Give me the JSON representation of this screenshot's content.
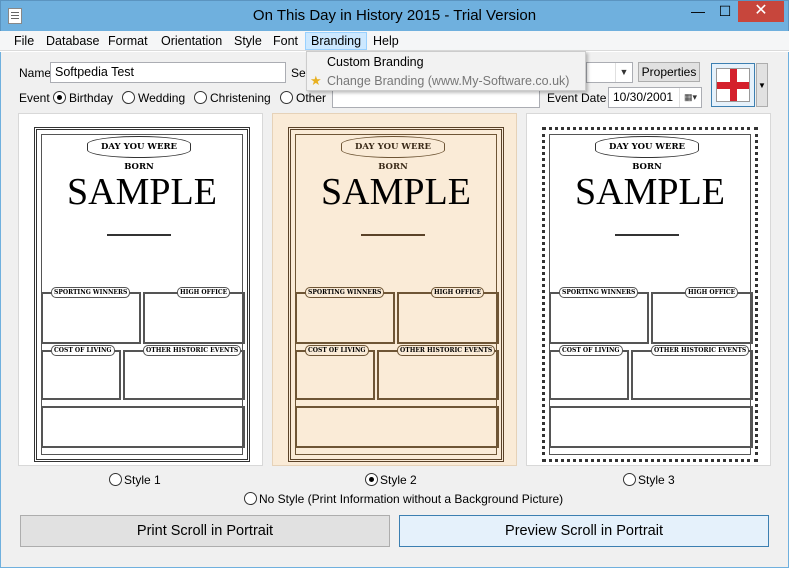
{
  "window": {
    "title": "On This Day in History 2015 - Trial Version",
    "minimize_glyph": "—",
    "maximize_glyph": "☐",
    "close_glyph": "✕"
  },
  "menu": [
    "File",
    "Database",
    "Format",
    "Orientation",
    "Style",
    "Font",
    "Branding",
    "Help"
  ],
  "branding_dropdown": {
    "items": [
      {
        "label": "Custom Branding"
      },
      {
        "label": "Change Branding (www.My-Software.co.uk)",
        "icon": "star-icon"
      }
    ]
  },
  "form": {
    "name_label": "Name",
    "name_value": "Softpedia Test",
    "select_label_partial": "Sel",
    "properties_button": "Properties",
    "event_label": "Event",
    "events": [
      {
        "label": "Birthday",
        "checked": true
      },
      {
        "label": "Wedding",
        "checked": false
      },
      {
        "label": "Christening",
        "checked": false
      },
      {
        "label": "Other",
        "checked": false
      }
    ],
    "other_value": "",
    "event_date_label": "Event Date",
    "event_date_value": "10/30/2001",
    "flag": "England flag (St George's cross)"
  },
  "previews": [
    {
      "banner": "DAY YOU WERE BORN",
      "sample": "SAMPLE",
      "boxes": [
        "SPORTING WINNERS",
        "HIGH OFFICE",
        "COST OF LIVING",
        "OTHER HISTORIC EVENTS"
      ],
      "radio_label": "Style 1",
      "checked": false
    },
    {
      "banner": "DAY YOU WERE BORN",
      "sample": "SAMPLE",
      "boxes": [
        "SPORTING WINNERS",
        "HIGH OFFICE",
        "COST OF LIVING",
        "OTHER HISTORIC EVENTS"
      ],
      "radio_label": "Style 2",
      "checked": true
    },
    {
      "banner": "DAY YOU WERE BORN",
      "sample": "SAMPLE",
      "boxes": [
        "SPORTING WINNERS",
        "HIGH OFFICE",
        "COST OF LIVING",
        "OTHER HISTORIC EVENTS"
      ],
      "radio_label": "Style 3",
      "checked": false
    }
  ],
  "no_style_label": "No Style (Print Information without a Background Picture)",
  "buttons": {
    "print": "Print Scroll in Portrait",
    "preview": "Preview Scroll in Portrait"
  },
  "colors": {
    "titlebar": "#6fb0de",
    "close_button": "#c7463c",
    "style2_background": "#faebd7"
  }
}
